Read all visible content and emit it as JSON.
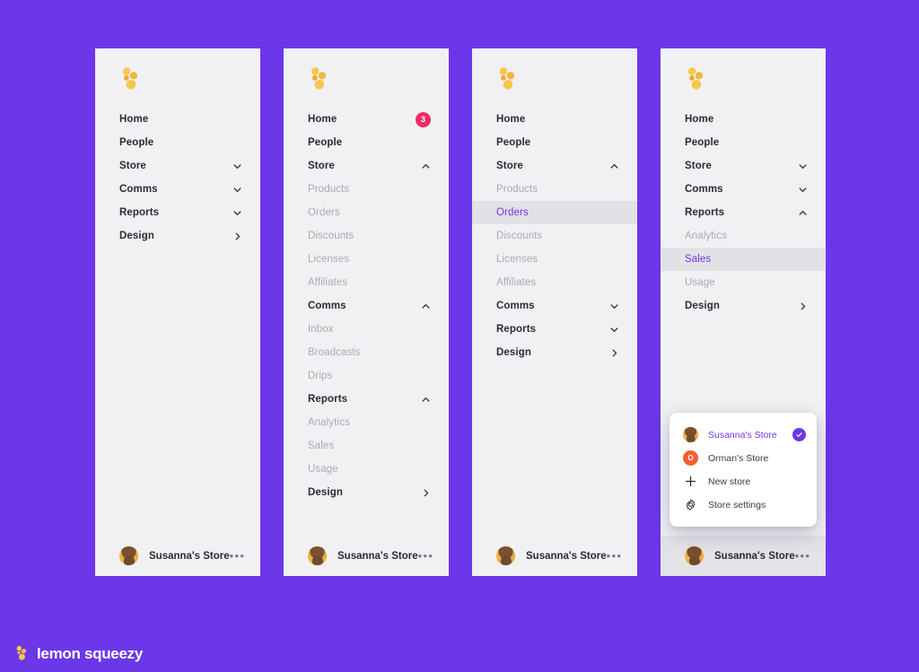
{
  "background_color": "#6B37E8",
  "panel_bg": "#F1F1F3",
  "accent_color": "#6B37E8",
  "badge_color": "#EE2D63",
  "footer_brand": {
    "icon": "lemon-squeezy-logo-icon",
    "word": "lemon squeezy"
  },
  "panels": [
    {
      "id": "panel-collapsed",
      "logo": "lemon-squeezy-logo-icon",
      "items": [
        {
          "label": "Home",
          "level": 1
        },
        {
          "label": "People",
          "level": 1
        },
        {
          "label": "Store",
          "level": 1,
          "chevron": "chevron-down-icon"
        },
        {
          "label": "Comms",
          "level": 1,
          "chevron": "chevron-down-icon"
        },
        {
          "label": "Reports",
          "level": 1,
          "chevron": "chevron-down-icon"
        },
        {
          "label": "Design",
          "level": 1,
          "chevron": "chevron-right-icon"
        }
      ],
      "footer": {
        "avatar": "user-avatar",
        "name": "Susanna's Store",
        "more": "•••",
        "highlight": false
      },
      "popup": null
    },
    {
      "id": "panel-all-expanded",
      "logo": "lemon-squeezy-logo-icon",
      "items": [
        {
          "label": "Home",
          "level": 1,
          "badge": "3"
        },
        {
          "label": "People",
          "level": 1
        },
        {
          "label": "Store",
          "level": 1,
          "chevron": "chevron-up-icon"
        },
        {
          "label": "Products",
          "level": 2
        },
        {
          "label": "Orders",
          "level": 2
        },
        {
          "label": "Discounts",
          "level": 2
        },
        {
          "label": "Licenses",
          "level": 2
        },
        {
          "label": "Affiliates",
          "level": 2
        },
        {
          "label": "Comms",
          "level": 1,
          "chevron": "chevron-up-icon"
        },
        {
          "label": "Inbox",
          "level": 2
        },
        {
          "label": "Broadcasts",
          "level": 2
        },
        {
          "label": "Drips",
          "level": 2
        },
        {
          "label": "Reports",
          "level": 1,
          "chevron": "chevron-up-icon"
        },
        {
          "label": "Analytics",
          "level": 2
        },
        {
          "label": "Sales",
          "level": 2
        },
        {
          "label": "Usage",
          "level": 2
        },
        {
          "label": "Design",
          "level": 1,
          "chevron": "chevron-right-icon"
        }
      ],
      "footer": {
        "avatar": "user-avatar",
        "name": "Susanna's Store",
        "more": "•••",
        "highlight": false
      },
      "popup": null
    },
    {
      "id": "panel-store-expanded",
      "logo": "lemon-squeezy-logo-icon",
      "items": [
        {
          "label": "Home",
          "level": 1
        },
        {
          "label": "People",
          "level": 1
        },
        {
          "label": "Store",
          "level": 1,
          "chevron": "chevron-up-icon"
        },
        {
          "label": "Products",
          "level": 2
        },
        {
          "label": "Orders",
          "level": 2,
          "active": true
        },
        {
          "label": "Discounts",
          "level": 2
        },
        {
          "label": "Licenses",
          "level": 2
        },
        {
          "label": "Affiliates",
          "level": 2
        },
        {
          "label": "Comms",
          "level": 1,
          "chevron": "chevron-down-icon"
        },
        {
          "label": "Reports",
          "level": 1,
          "chevron": "chevron-down-icon"
        },
        {
          "label": "Design",
          "level": 1,
          "chevron": "chevron-right-icon"
        }
      ],
      "footer": {
        "avatar": "user-avatar",
        "name": "Susanna's Store",
        "more": "•••",
        "highlight": false
      },
      "popup": null
    },
    {
      "id": "panel-reports-expanded",
      "logo": "lemon-squeezy-logo-icon",
      "items": [
        {
          "label": "Home",
          "level": 1
        },
        {
          "label": "People",
          "level": 1
        },
        {
          "label": "Store",
          "level": 1,
          "chevron": "chevron-down-icon"
        },
        {
          "label": "Comms",
          "level": 1,
          "chevron": "chevron-down-icon"
        },
        {
          "label": "Reports",
          "level": 1,
          "chevron": "chevron-up-icon"
        },
        {
          "label": "Analytics",
          "level": 2
        },
        {
          "label": "Sales",
          "level": 2,
          "active": true
        },
        {
          "label": "Usage",
          "level": 2
        },
        {
          "label": "Design",
          "level": 1,
          "chevron": "chevron-right-icon"
        }
      ],
      "footer": {
        "avatar": "user-avatar",
        "name": "Susanna's Store",
        "more": "•••",
        "highlight": true
      },
      "popup": {
        "rows": [
          {
            "label": "Susanna's Store",
            "icon": "store-avatar-photo",
            "selected": true,
            "check": "check-icon"
          },
          {
            "label": "Orman's Store",
            "icon": "store-avatar-letter",
            "letter": "O",
            "selected": false
          },
          {
            "label": "New store",
            "icon": "plus-icon",
            "selected": false
          },
          {
            "label": "Store settings",
            "icon": "gear-icon",
            "selected": false
          }
        ]
      }
    }
  ]
}
